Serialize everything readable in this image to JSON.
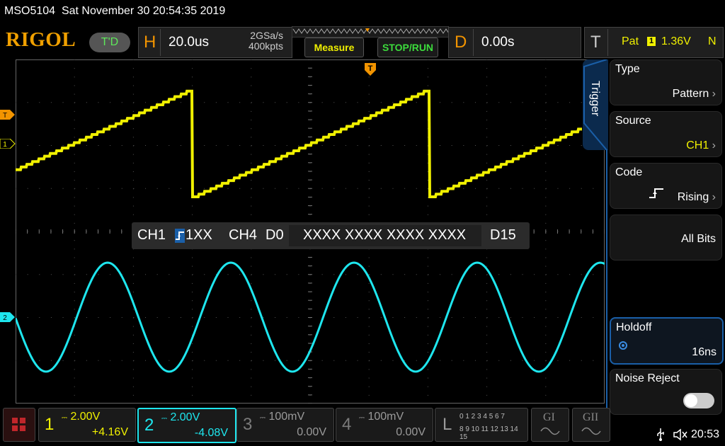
{
  "title_bar": {
    "model": "MSO5104",
    "datetime": "Sat November 30 20:54:35 2019"
  },
  "logo": "RIGOL",
  "run_state": "T'D",
  "horizontal": {
    "letter": "H",
    "timebase": "20.0us",
    "sample_rate": "2GSa/s",
    "memory_depth": "400kpts"
  },
  "buttons": {
    "measure": "Measure",
    "stop_run": "STOP/RUN"
  },
  "delay": {
    "letter": "D",
    "value": "0.00s"
  },
  "trigger_status": {
    "letter": "T",
    "type_short": "Pat",
    "source_num": "1",
    "level": "1.36V",
    "mode": "N"
  },
  "markers": {
    "trigger_pos": "T",
    "trig_level": "T",
    "ch1": "1",
    "ch2": "2"
  },
  "pattern_bar": {
    "ch1": "CH1",
    "ch1_code": "1XX",
    "ch4": "CH4",
    "d0": "D0",
    "bits": "XXXX XXXX XXXX XXXX",
    "d15": "D15"
  },
  "menu": {
    "tab": "Trigger",
    "type": {
      "label": "Type",
      "value": "Pattern"
    },
    "source": {
      "label": "Source",
      "value": "CH1"
    },
    "code": {
      "label": "Code",
      "value": "Rising"
    },
    "all_bits": {
      "value": "All Bits"
    },
    "holdoff": {
      "label": "Holdoff",
      "value": "16ns"
    },
    "noise_reject": {
      "label": "Noise Reject"
    }
  },
  "channels": [
    {
      "num": "1",
      "scale": "2.00V",
      "offset": "+4.16V",
      "color": "#f0f000"
    },
    {
      "num": "2",
      "scale": "2.00V",
      "offset": "-4.08V",
      "color": "#1ee6ee"
    },
    {
      "num": "3",
      "scale": "100mV",
      "offset": "0.00V",
      "color": "#7a7a7a"
    },
    {
      "num": "4",
      "scale": "100mV",
      "offset": "0.00V",
      "color": "#7a7a7a"
    }
  ],
  "logic": {
    "letter": "L",
    "row1": "0 1 2 3  4 5 6 7",
    "row2": "8 9 10 11 12 13 14 15"
  },
  "generators": {
    "g1": "GI",
    "g2": "GII"
  },
  "clock": "20:53",
  "colors": {
    "ch1": "#f0f000",
    "ch2": "#1ee6ee",
    "accent": "#f29400",
    "menu_active": "#1a5fa8"
  }
}
